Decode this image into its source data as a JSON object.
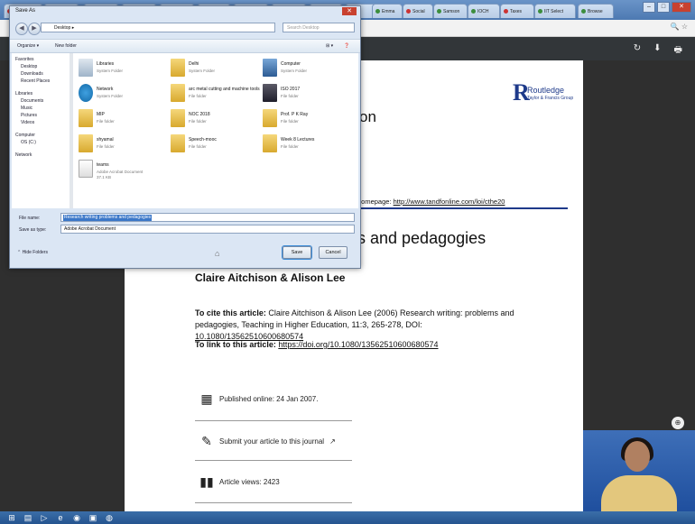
{
  "browser": {
    "tabs": [
      "Save As",
      "",
      "",
      "",
      "",
      "",
      "",
      "",
      "",
      "",
      "",
      "Emma",
      "Social",
      "Samson",
      "IOCH",
      "Taxes",
      "IIT Select",
      "Browse"
    ],
    "window_buttons": [
      "–",
      "□",
      "✕"
    ]
  },
  "dialog": {
    "title": "Save As",
    "path": "Desktop ▸",
    "search_placeholder": "Search Desktop",
    "toolbar": {
      "organize": "Organize ▾",
      "new_folder": "New folder",
      "view": "⊞ ▾",
      "help": "❓"
    },
    "sidebar": [
      {
        "label": "Favorites",
        "sub": false
      },
      {
        "label": "Desktop",
        "sub": true
      },
      {
        "label": "Downloads",
        "sub": true
      },
      {
        "label": "Recent Places",
        "sub": true
      },
      {
        "label": "Libraries",
        "sub": false
      },
      {
        "label": "Documents",
        "sub": true
      },
      {
        "label": "Music",
        "sub": true
      },
      {
        "label": "Pictures",
        "sub": true
      },
      {
        "label": "Videos",
        "sub": true
      },
      {
        "label": "Computer",
        "sub": false
      },
      {
        "label": "OS (C:)",
        "sub": true
      },
      {
        "label": "Network",
        "sub": false
      }
    ],
    "files": [
      {
        "name": "Libraries",
        "type": "System Folder",
        "size": ""
      },
      {
        "name": "Delhi",
        "type": "System Folder",
        "size": ""
      },
      {
        "name": "Computer",
        "type": "System Folder",
        "size": ""
      },
      {
        "name": "Network",
        "type": "System Folder",
        "size": ""
      },
      {
        "name": "arc metal cutting and machine tools",
        "type": "File folder",
        "size": ""
      },
      {
        "name": "ISO 2017",
        "type": "File folder",
        "size": ""
      },
      {
        "name": "MIP",
        "type": "File folder",
        "size": ""
      },
      {
        "name": "NOC 2018",
        "type": "File folder",
        "size": ""
      },
      {
        "name": "Prof. P K Ray",
        "type": "File folder",
        "size": ""
      },
      {
        "name": "shyamal",
        "type": "File folder",
        "size": ""
      },
      {
        "name": "Speech-mooc",
        "type": "File folder",
        "size": ""
      },
      {
        "name": "Week 8 Lectures",
        "type": "File folder",
        "size": ""
      },
      {
        "name": "teams",
        "type": "Adobe Acrobat Document",
        "size": "37.1 KB"
      }
    ],
    "file_name_label": "File name:",
    "file_name_value": "Research writing problems and pedagogies",
    "save_type_label": "Save as type:",
    "save_type_value": "Adobe Acrobat Document",
    "hide_folders": "Hide Folders",
    "save_button": "Save",
    "cancel_button": "Cancel"
  },
  "pdf": {
    "tools": [
      "↻",
      "⬇",
      "🖶"
    ],
    "logo_name": "Routledge",
    "logo_sub": "Taylor & Francis Group",
    "title_fragment_top": "on",
    "homepage_prefix": "homepage: ",
    "homepage_url": "http://www.tandfonline.com/loi/cthe20",
    "title_fragment": "s and pedagogies",
    "authors": "Claire Aitchison & Alison Lee",
    "cite_label": "To cite this article:",
    "cite_text": " Claire Aitchison & Alison Lee (2006) Research writing: problems and pedagogies, Teaching in Higher Education, 11:3, 265-278, DOI: ",
    "cite_doi": "10.1080/13562510600680574",
    "link_label": "To link to this article: ",
    "link_url": "https://doi.org/10.1080/13562510600680574",
    "published": "Published online: 24 Jan 2007.",
    "submit": "Submit your article to this journal",
    "views": "Article views: 2423"
  }
}
